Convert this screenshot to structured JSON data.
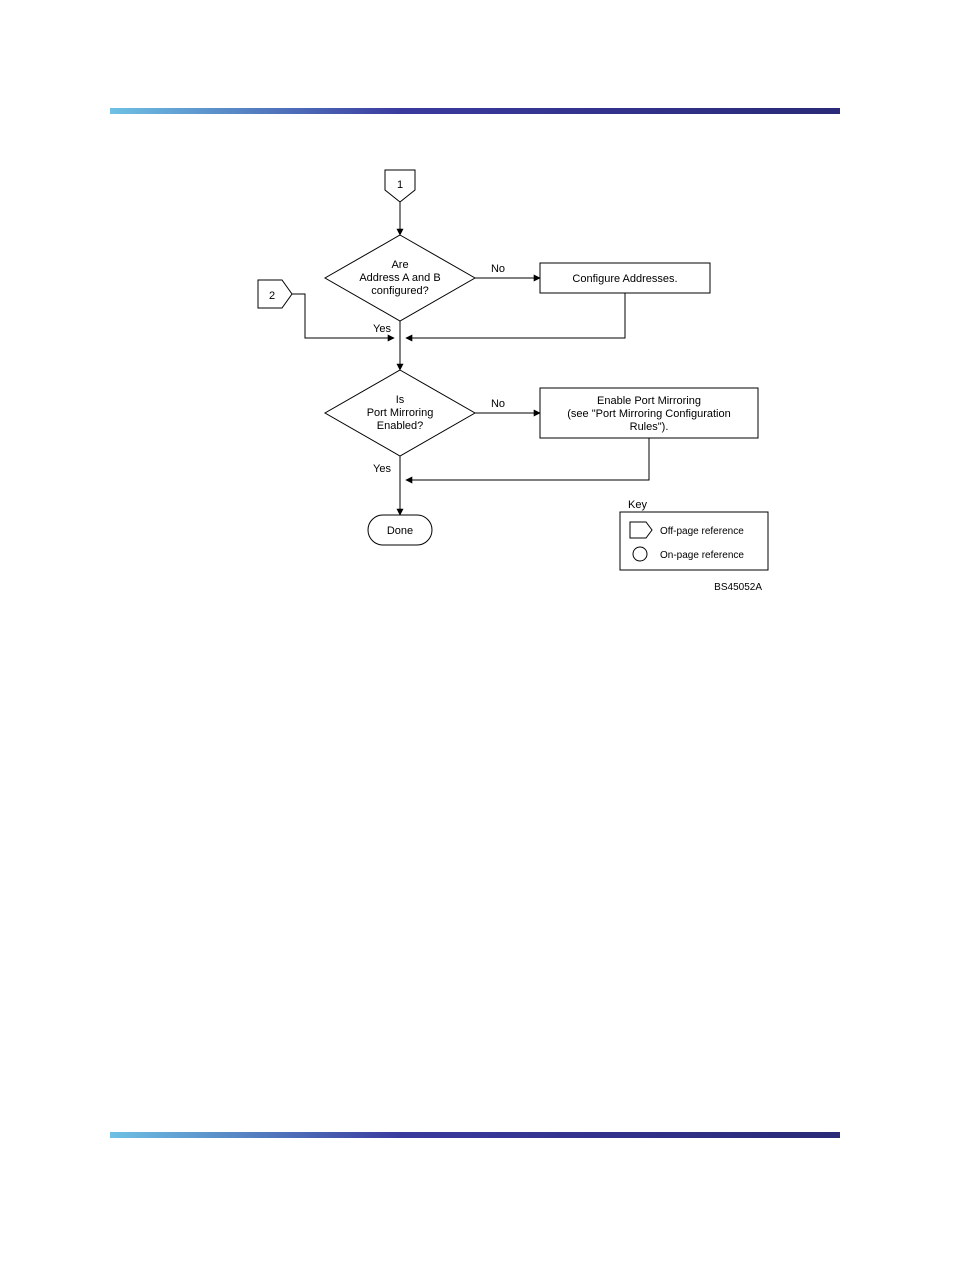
{
  "chart_data": {
    "type": "flowchart",
    "title": "",
    "nodes": [
      {
        "id": "ref1",
        "type": "offpage-ref",
        "label": "1"
      },
      {
        "id": "ref2",
        "type": "offpage-ref",
        "label": "2"
      },
      {
        "id": "decisionA",
        "type": "decision",
        "label": "Are\nAddress A and B\nconfigured?"
      },
      {
        "id": "configAddr",
        "type": "process",
        "label": "Configure Addresses."
      },
      {
        "id": "decisionB",
        "type": "decision",
        "label": "Is\nPort Mirroring\nEnabled?"
      },
      {
        "id": "enableMirr",
        "type": "process",
        "label": "Enable Port Mirroring\n(see \"Port Mirroring Configuration\nRules\")."
      },
      {
        "id": "done",
        "type": "terminator",
        "label": "Done"
      }
    ],
    "edges": [
      {
        "from": "ref1",
        "to": "decisionA",
        "label": ""
      },
      {
        "from": "decisionA",
        "to": "configAddr",
        "label": "No"
      },
      {
        "from": "decisionA",
        "to": "decisionB",
        "label": "Yes"
      },
      {
        "from": "ref2",
        "to": "decisionB",
        "label": ""
      },
      {
        "from": "configAddr",
        "to": "decisionB",
        "label": ""
      },
      {
        "from": "decisionB",
        "to": "enableMirr",
        "label": "No"
      },
      {
        "from": "decisionB",
        "to": "done",
        "label": "Yes"
      },
      {
        "from": "enableMirr",
        "to": "done",
        "label": ""
      }
    ],
    "legend": {
      "title": "Key",
      "items": [
        {
          "shape": "offpage-ref",
          "label": "Off-page reference"
        },
        {
          "shape": "circle",
          "label": "On-page reference"
        }
      ]
    },
    "reference_code": "BS45052A"
  },
  "edge_labels": {
    "no": "No",
    "yes": "Yes"
  }
}
